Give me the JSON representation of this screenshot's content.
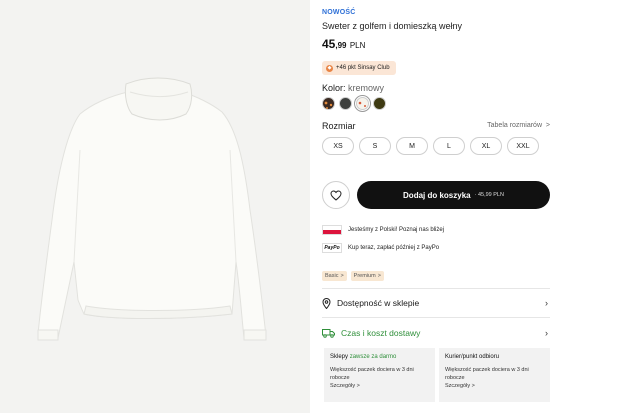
{
  "product": {
    "badge": "NOWOŚĆ",
    "name": "Sweter z golfem i domieszką wełny",
    "price_int": "45",
    "price_dec": ",99",
    "currency": "PLN"
  },
  "club": {
    "icon": "club-icon",
    "text": "+46 pkt Sinsay Club"
  },
  "color": {
    "label": "Kolor:",
    "value": "kremowy",
    "swatches": [
      {
        "name": "brown-pattern",
        "hex": "#3b2a22"
      },
      {
        "name": "dark-grey",
        "hex": "#3d3f3d"
      },
      {
        "name": "cream",
        "hex": "#f6f3ec",
        "selected": true
      },
      {
        "name": "olive",
        "hex": "#3e3a12"
      }
    ]
  },
  "size": {
    "label": "Rozmiar",
    "table_link": "Tabela rozmiarów",
    "options": [
      "XS",
      "S",
      "M",
      "L",
      "XL",
      "XXL"
    ]
  },
  "actions": {
    "wishlist_icon": "heart-icon",
    "cart_label": "Dodaj do koszyka",
    "cart_price": "· 45,99 PLN"
  },
  "info": {
    "poland": "Jesteśmy z Polski! Poznaj nas bliżej",
    "paypo_logo": "PayPo",
    "paypo": "Kup teraz, zapłać później z PayPo"
  },
  "tags": [
    "Basic",
    "Premium"
  ],
  "availability": {
    "label": "Dostępność w sklepie",
    "icon": "location-pin-icon"
  },
  "delivery": {
    "label": "Czas i koszt dostawy",
    "icon": "truck-icon",
    "color": "#2f8f3a"
  },
  "cards": [
    {
      "title": "Sklepy",
      "title_highlight": "zawsze za darmo",
      "body": "Większość paczek dociera w 3 dni robocze",
      "link": "Szczegóły >"
    },
    {
      "title": "Kurier/punkt odbioru",
      "title_highlight": "",
      "body": "Większość paczek dociera w 3 dni robocze",
      "link": "Szczegóły >"
    }
  ]
}
